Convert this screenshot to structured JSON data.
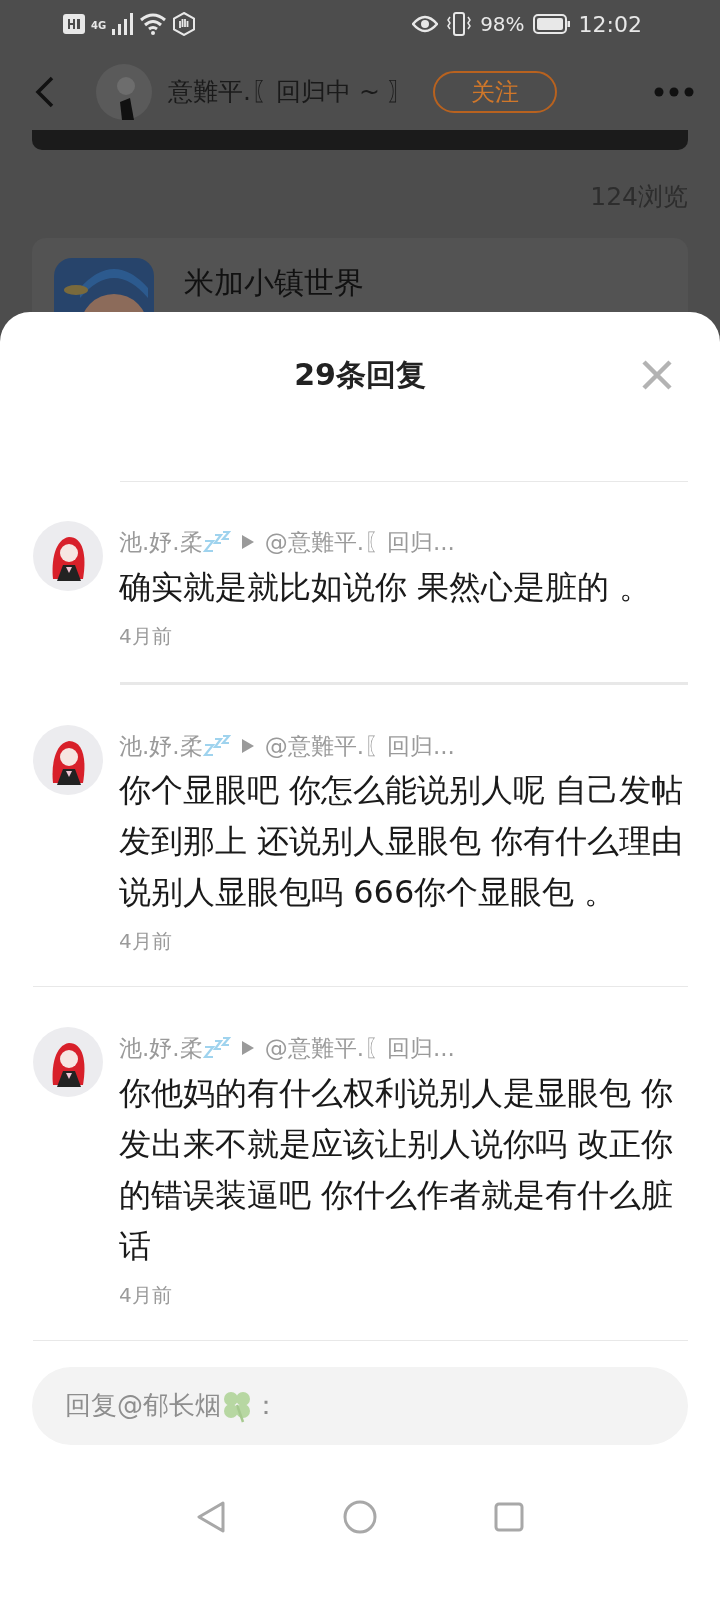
{
  "status_bar": {
    "network": "4G",
    "battery": "98%",
    "time": "12:02"
  },
  "header": {
    "author": "意難平.〖回归中 ~ 〗",
    "follow_button": "关注",
    "views": "124浏览",
    "app_name": "米加小镇世界"
  },
  "sheet": {
    "title": "29条回复",
    "comments": [
      {
        "name": "池.妤.柔",
        "reply_to": "@意難平.〖回归...",
        "text": "确实就是就比如说你 果然心是脏的 。",
        "time": "4月前"
      },
      {
        "name": "池.妤.柔",
        "reply_to": "@意難平.〖回归...",
        "text": "你个显眼吧 你怎么能说别人呢 自己发帖发到那上 还说别人显眼包 你有什么理由说别人显眼包吗 666你个显眼包 。",
        "time": "4月前"
      },
      {
        "name": "池.妤.柔",
        "reply_to": "@意難平.〖回归...",
        "text": "你他妈的有什么权利说别人是显眼包 你发出来不就是应该让别人说你吗 改正你的错误装逼吧 你什么作者就是有什么脏话",
        "time": "4月前"
      }
    ],
    "reply_field": {
      "placeholder": "回复@郁长烟",
      "placeholder_end": "："
    }
  }
}
